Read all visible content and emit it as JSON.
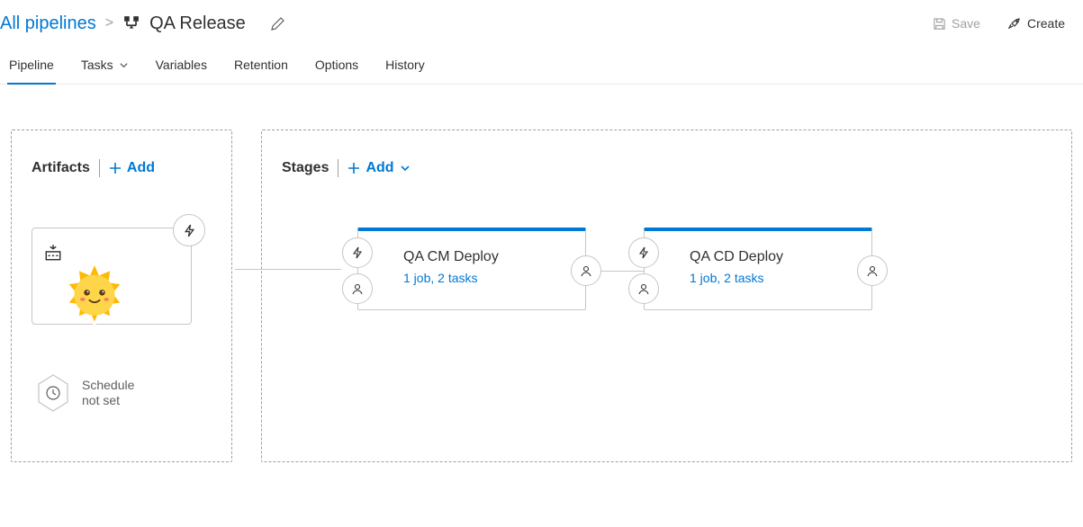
{
  "breadcrumb": {
    "root_label": "All pipelines",
    "title": "QA Release"
  },
  "actions": {
    "save": "Save",
    "create": "Create"
  },
  "tabs": {
    "pipeline": "Pipeline",
    "tasks": "Tasks",
    "variables": "Variables",
    "retention": "Retention",
    "options": "Options",
    "history": "History"
  },
  "artifacts": {
    "title": "Artifacts",
    "add": "Add",
    "schedule_label": "Schedule\nnot set"
  },
  "stages": {
    "title": "Stages",
    "add": "Add",
    "items": [
      {
        "name": "QA CM Deploy",
        "summary": "1 job, 2 tasks"
      },
      {
        "name": "QA CD Deploy",
        "summary": "1 job, 2 tasks"
      }
    ]
  }
}
